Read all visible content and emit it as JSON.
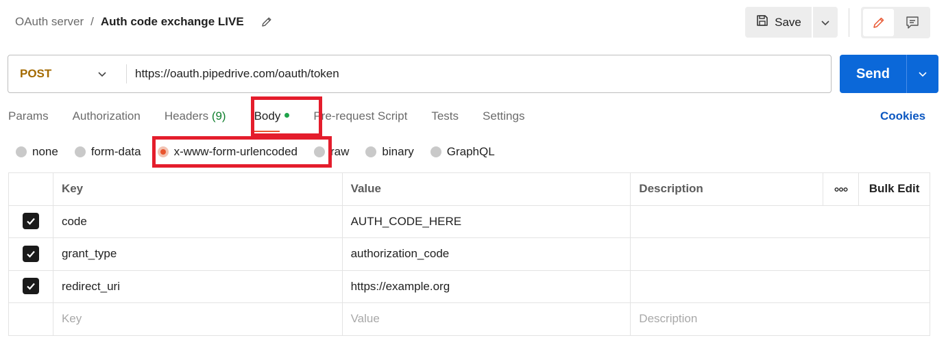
{
  "header": {
    "breadcrumb_parent": "OAuth server",
    "breadcrumb_sep": "/",
    "request_title": "Auth code exchange LIVE",
    "save_label": "Save"
  },
  "request": {
    "method": "POST",
    "url": "https://oauth.pipedrive.com/oauth/token",
    "send_label": "Send"
  },
  "tabs": [
    {
      "label": "Params"
    },
    {
      "label": "Authorization"
    },
    {
      "label": "Headers",
      "count": "(9)"
    },
    {
      "label": "Body",
      "active": true
    },
    {
      "label": "Pre-request Script"
    },
    {
      "label": "Tests"
    },
    {
      "label": "Settings"
    }
  ],
  "cookies_label": "Cookies",
  "body_types": [
    "none",
    "form-data",
    "x-www-form-urlencoded",
    "raw",
    "binary",
    "GraphQL"
  ],
  "body_type_selected": "x-www-form-urlencoded",
  "table": {
    "headers": {
      "key": "Key",
      "value": "Value",
      "description": "Description",
      "bulk_edit": "Bulk Edit",
      "more": "ooo"
    },
    "rows": [
      {
        "key": "code",
        "value": "AUTH_CODE_HERE",
        "description": "",
        "checked": true
      },
      {
        "key": "grant_type",
        "value": "authorization_code",
        "description": "",
        "checked": true
      },
      {
        "key": "redirect_uri",
        "value": "https://example.org",
        "description": "",
        "checked": true
      }
    ],
    "placeholders": {
      "key": "Key",
      "value": "Value",
      "description": "Description"
    }
  },
  "colors": {
    "accent": "#e8552f",
    "send": "#0b68d9",
    "method": "#a36a00",
    "highlight": "#e41d2c",
    "body_dot": "#1fa34a"
  }
}
